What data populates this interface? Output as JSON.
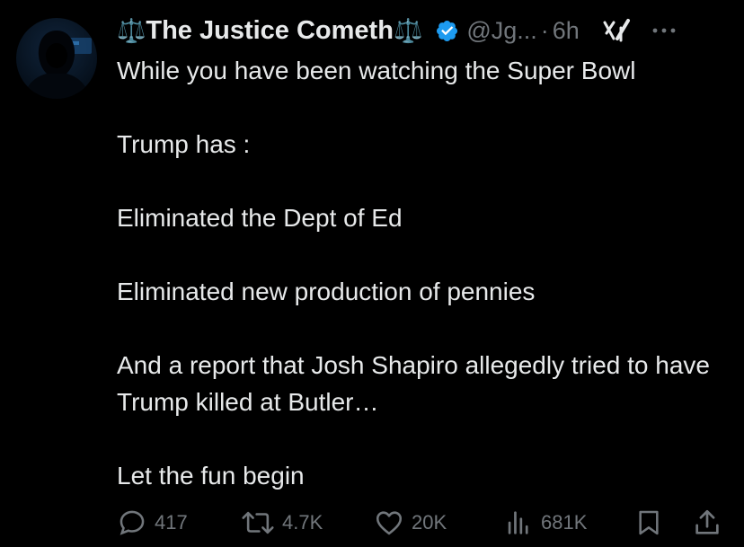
{
  "header": {
    "display_name": "The Justice Cometh",
    "scales_glyph": "⚖️",
    "handle": "@Jg...",
    "separator": "·",
    "time": "6h",
    "icons": [
      "verified-badge-icon",
      "grok-icon",
      "more-icon"
    ]
  },
  "avatar": {
    "description_icon": "hooded-figure-avatar"
  },
  "tweet": {
    "paragraphs": [
      "While you have been watching the Super Bowl",
      "Trump has :",
      "Eliminated the Dept of Ed",
      "Eliminated new production of pennies",
      "And a report that Josh Shapiro allegedly tried to have Trump killed at Butler…",
      "Let the fun begin"
    ]
  },
  "actions": {
    "replies": "417",
    "reposts": "4.7K",
    "likes": "20K",
    "views": "681K",
    "icons": [
      "reply-icon",
      "repost-icon",
      "like-icon",
      "views-icon",
      "bookmark-icon",
      "share-icon"
    ]
  },
  "colors": {
    "background": "#000000",
    "text": "#e7e9ea",
    "secondary": "#71767b",
    "verified": "#1d9bf0"
  }
}
